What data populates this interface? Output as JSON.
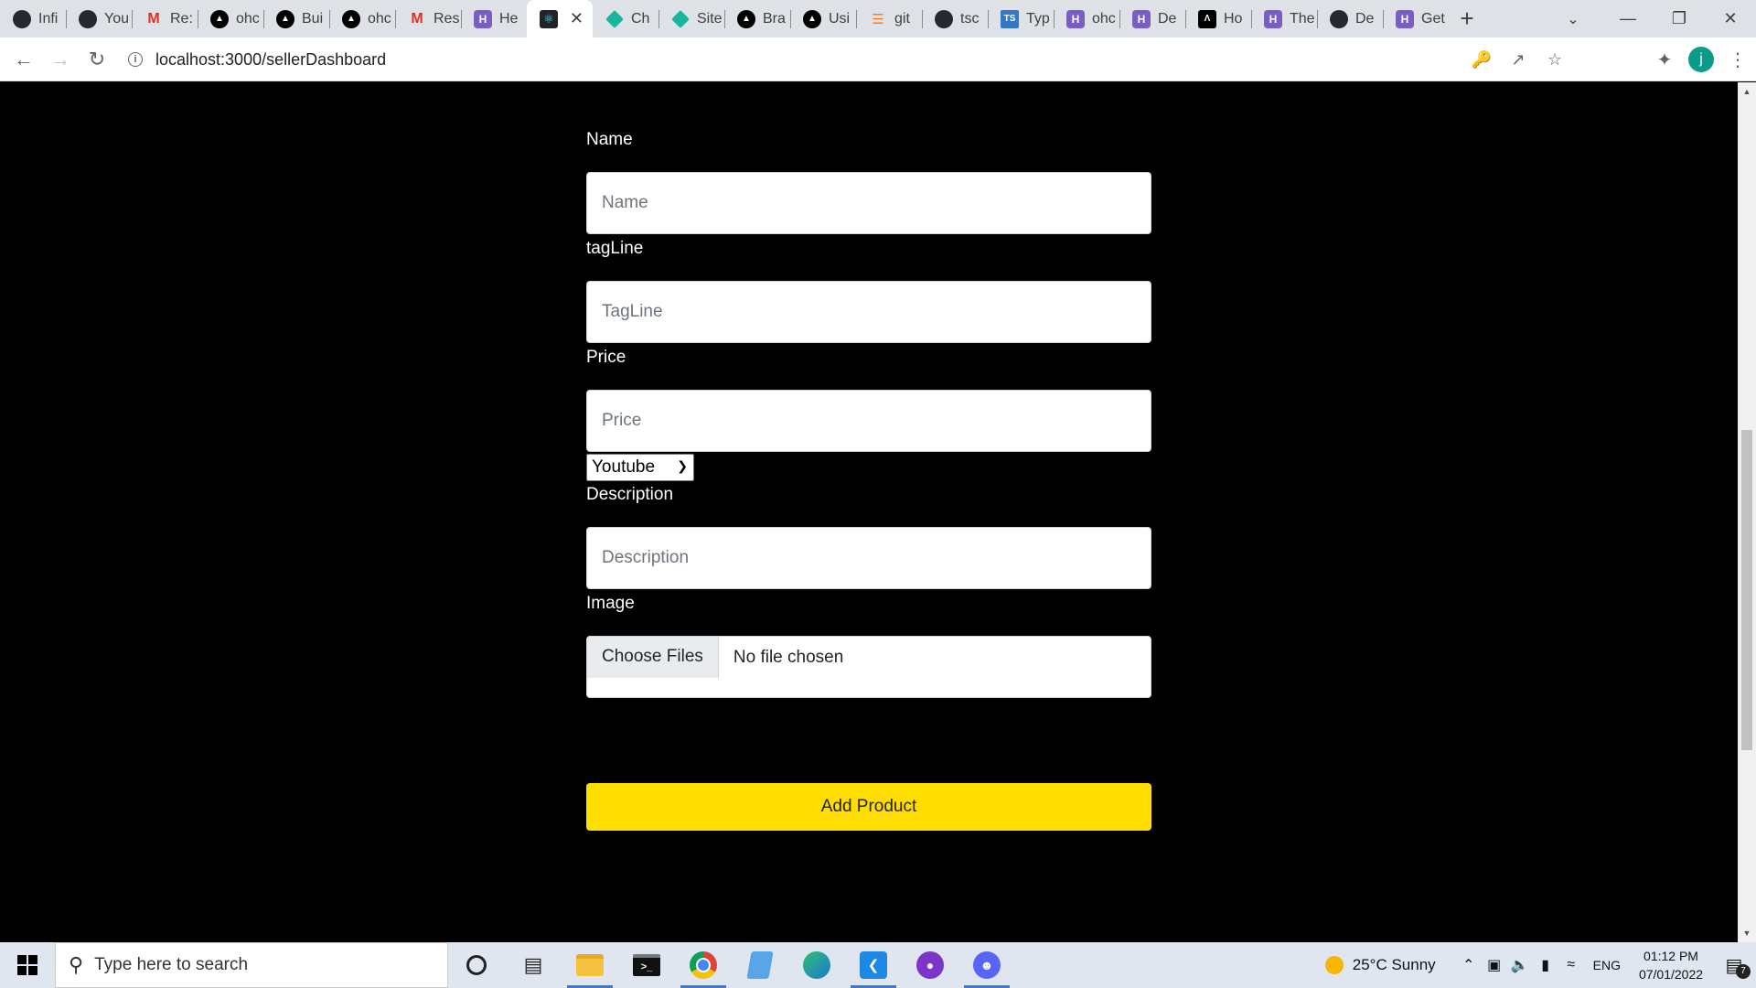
{
  "browser": {
    "tabs": [
      {
        "title": "Infi",
        "icon": "github-icon",
        "kind": "gh"
      },
      {
        "title": "You",
        "icon": "github-icon",
        "kind": "gh"
      },
      {
        "title": "Re:",
        "icon": "gmail-icon",
        "kind": "gm"
      },
      {
        "title": "ohc",
        "icon": "triangle-icon",
        "kind": "tri"
      },
      {
        "title": "Bui",
        "icon": "triangle-icon",
        "kind": "tri"
      },
      {
        "title": "ohc",
        "icon": "triangle-icon",
        "kind": "tri"
      },
      {
        "title": "Res",
        "icon": "gmail-icon",
        "kind": "gm"
      },
      {
        "title": "He",
        "icon": "hashnode-icon",
        "kind": "hn"
      },
      {
        "title": "",
        "icon": "react-icon",
        "kind": "react",
        "active": true
      },
      {
        "title": "Ch",
        "icon": "diamond-icon",
        "kind": "diamond"
      },
      {
        "title": "Site",
        "icon": "diamond-icon",
        "kind": "diamond"
      },
      {
        "title": "Bra",
        "icon": "triangle-icon",
        "kind": "tri"
      },
      {
        "title": "Usi",
        "icon": "triangle-icon",
        "kind": "tri"
      },
      {
        "title": "git",
        "icon": "stackoverflow-icon",
        "kind": "so"
      },
      {
        "title": "tsc",
        "icon": "github-icon",
        "kind": "gh"
      },
      {
        "title": "Typ",
        "icon": "typescript-icon",
        "kind": "ts"
      },
      {
        "title": "ohc",
        "icon": "hashnode-icon",
        "kind": "hn"
      },
      {
        "title": "De",
        "icon": "hashnode-icon",
        "kind": "hn"
      },
      {
        "title": "Ho",
        "icon": "angular-icon",
        "kind": "ah"
      },
      {
        "title": "The",
        "icon": "hashnode-icon",
        "kind": "hn"
      },
      {
        "title": "De",
        "icon": "github-icon",
        "kind": "gh"
      },
      {
        "title": "Get",
        "icon": "hashnode-icon",
        "kind": "hn"
      }
    ],
    "url": "localhost:3000/sellerDashboard",
    "profile_initial": "j"
  },
  "form": {
    "name_label": "Name",
    "name_placeholder": "Name",
    "tagline_label": "tagLine",
    "tagline_placeholder": "TagLine",
    "price_label": "Price",
    "price_placeholder": "Price",
    "platform_selected": "Youtube",
    "description_label": "Description",
    "description_placeholder": "Description",
    "image_label": "Image",
    "file_button": "Choose Files",
    "file_status": "No file chosen",
    "submit_label": "Add Product",
    "submit_color": "#ffdd00"
  },
  "taskbar": {
    "search_placeholder": "Type here to search",
    "weather": "25°C  Sunny",
    "lang": "ENG",
    "time": "01:12 PM",
    "date": "07/01/2022",
    "notification_count": "7"
  }
}
